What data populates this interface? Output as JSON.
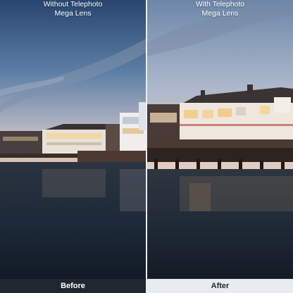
{
  "left_panel": {
    "caption_line1": "Without Telephoto",
    "caption_line2": "Mega Lens",
    "footer_label": "Before"
  },
  "right_panel": {
    "caption_line1": "With Telephoto",
    "caption_line2": "Mega Lens",
    "footer_label": "After"
  }
}
